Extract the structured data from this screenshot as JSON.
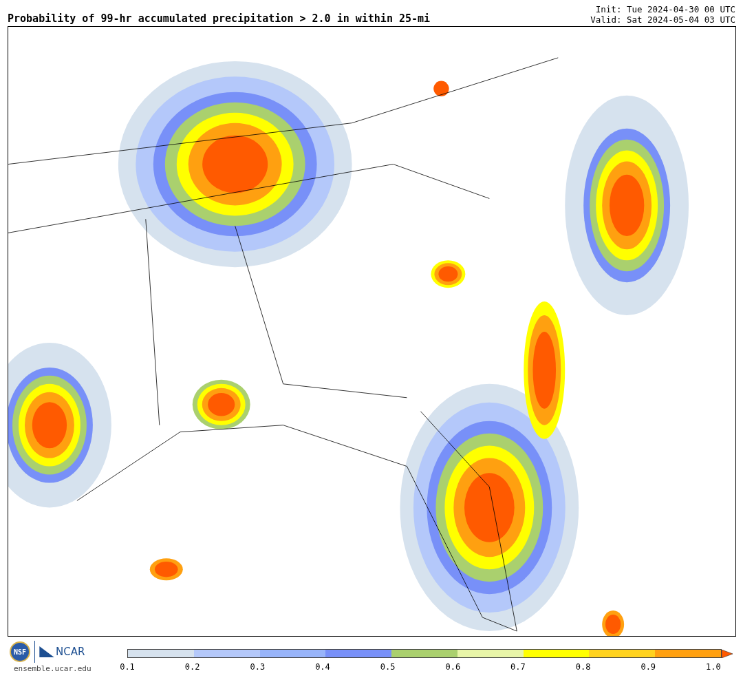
{
  "title": "Probability of 99-hr accumulated precipitation > 2.0 in within 25-mi",
  "init": "Init: Tue 2024-04-30 00 UTC",
  "valid": "Valid: Sat 2024-05-04 03 UTC",
  "logos": {
    "nsf": "NSF",
    "ncar": "NCAR",
    "url": "ensemble.ucar.edu"
  },
  "colorbar": {
    "segments": [
      {
        "color": "#d6e2ee"
      },
      {
        "color": "#b4c8fa"
      },
      {
        "color": "#98b4fa"
      },
      {
        "color": "#7890f8"
      },
      {
        "color": "#aad06e"
      },
      {
        "color": "#e8f5a8"
      },
      {
        "color": "#ffff00"
      },
      {
        "color": "#ffd21e"
      },
      {
        "color": "#ffa010"
      }
    ],
    "end_arrow": {
      "color": "#ff5a00"
    },
    "ticks": [
      "0.1",
      "0.2",
      "0.3",
      "0.4",
      "0.5",
      "0.6",
      "0.7",
      "0.8",
      "0.9",
      "1.0"
    ]
  }
}
